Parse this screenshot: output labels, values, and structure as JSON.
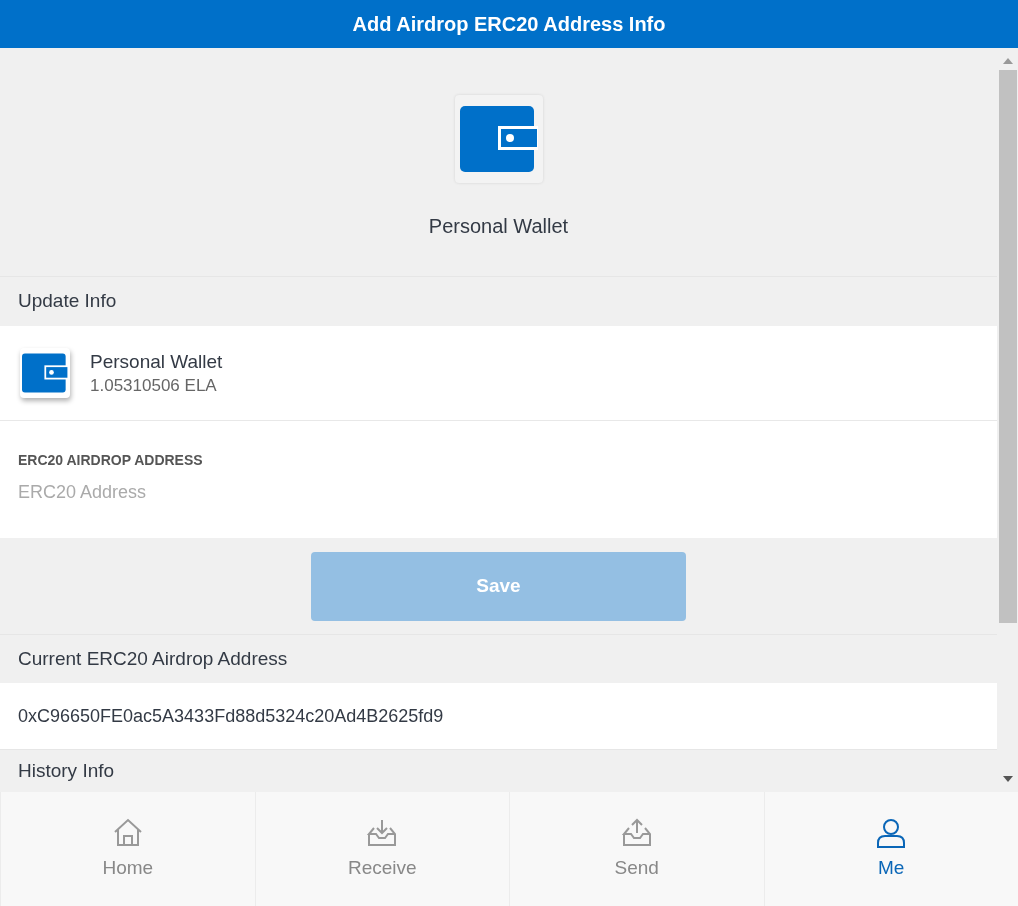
{
  "header": {
    "title": "Add Airdrop ERC20 Address Info"
  },
  "wallet_hero": {
    "name": "Personal Wallet"
  },
  "update_info": {
    "heading": "Update Info",
    "wallet": {
      "name": "Personal Wallet",
      "balance": "1.05310506 ELA"
    },
    "field": {
      "label": "ERC20 AIRDROP ADDRESS",
      "placeholder": "ERC20 Address"
    },
    "save_button": {
      "label": "Save",
      "disabled": true
    }
  },
  "current_address": {
    "heading": "Current ERC20 Airdrop Address",
    "value": "0xC96650FE0ac5A3433Fd88d5324c20Ad4B2625fd9"
  },
  "history": {
    "heading": "History Info"
  },
  "tabs": [
    {
      "kind": "home",
      "label": "Home",
      "selected": false
    },
    {
      "kind": "receive",
      "label": "Receive",
      "selected": false
    },
    {
      "kind": "send",
      "label": "Send",
      "selected": false
    },
    {
      "kind": "me",
      "label": "Me",
      "selected": true
    }
  ]
}
